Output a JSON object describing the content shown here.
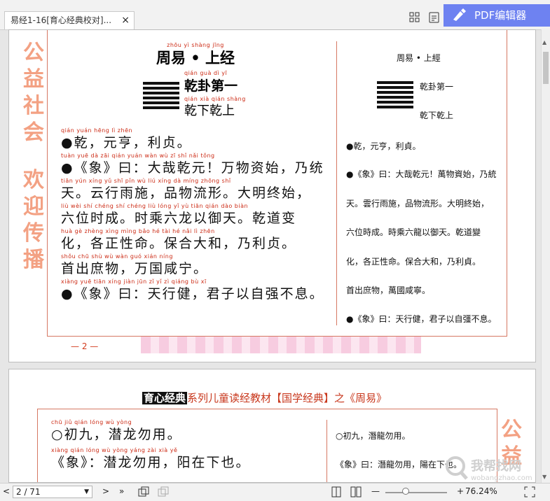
{
  "tab": {
    "title": "易经1-16[育心经典校对]...",
    "close": "×"
  },
  "toolbar": {
    "pdf_editor": "PDF编辑器"
  },
  "side_left": [
    "公",
    "益",
    "社",
    "会",
    "欢",
    "迎",
    "传",
    "播"
  ],
  "page1": {
    "title_py": "zhōu  yì       shàng jīng",
    "title": "周易 • 上经",
    "hex_py": "qián guà   dì   yī",
    "hex_name": "乾卦第一",
    "hex_sub_py": "qián  xià  qián shàng",
    "hex_sub": "乾下乾上",
    "lines": [
      {
        "py": "qián         yuán hēng          lì   zhēn",
        "text": "●乾，元亨，利贞。"
      },
      {
        "py": "tuàn           yuē        dà  zāi qián yuán      wàn  wù   zī   shǐ        nǎi  tǒng",
        "text": "●《象》曰：大哉乾元！万物资始，乃统"
      },
      {
        "py": "tiān      yún xíng yǔ  shī       pǐn  wù  liú  xíng      dà  míng zhōng shǐ",
        "text": "天。云行雨施，品物流形。大明终始，"
      },
      {
        "py": "liù  wèi  shí chéng      shí chéng liù lóng  yǐ   yù  tiān      qián dào biàn",
        "text": "六位时成。时乘六龙以御天。乾道变"
      },
      {
        "py": "huà      gè zhèng xìng mìng       bǎo  hé  tài   hé         nǎi   lì   zhēn",
        "text": "化，各正性命。保合大和，乃利贞。"
      },
      {
        "py": "shǒu chū shù wù       wàn guó xián níng",
        "text": "首出庶物，万国咸宁。"
      },
      {
        "py": "xiàng          yuē        tiān xíng jiàn      jūn  zǐ   yǐ   zì qiáng bù   xī",
        "text": "●《象》曰：天行健，君子以自强不息。"
      }
    ],
    "right": {
      "title": "周易 • 上經",
      "hex_name": "乾卦第一",
      "hex_sub": "乾下乾上",
      "lines": [
        "●乾，元亨，利貞。",
        "●《象》曰：大哉乾元！萬物資始，乃統",
        "天。雲行雨施，品物流形。大明終始，",
        "六位時成。時乘六龍以御天。乾道變",
        "化，各正性命。保合大和，乃利貞。",
        "首出庶物，萬國咸寧。",
        "●《象》曰：天行健，君子以自彊不息。"
      ]
    },
    "page_number": "— 2 —"
  },
  "page2": {
    "badge": "育心经典",
    "series": "系列儿童读经教材【国学经典】之《周易》",
    "lines": [
      {
        "py": "chū  jiǔ       qián lóng  wù  yòng",
        "text": "○初九，潜龙勿用。"
      },
      {
        "py": "xiàng          qián lóng  wù yòng       yáng zài   xià   yě",
        "text": "《象》：潜龙勿用，阳在下也。"
      }
    ],
    "right_lines": [
      "○初九，潛龍勿用。",
      "《象》曰：潛龍勿用，陽在下也。"
    ],
    "side": [
      "公",
      "益"
    ]
  },
  "status": {
    "page": "2 / 71",
    "zoom": "76.24%"
  },
  "watermark": {
    "title": "我帮找网",
    "url": "wobangzhao.com"
  },
  "colors": {
    "accent": "#6e82f1",
    "frame": "#d67863",
    "pinyin": "#cc2a14",
    "side_text": "#f3a183"
  }
}
